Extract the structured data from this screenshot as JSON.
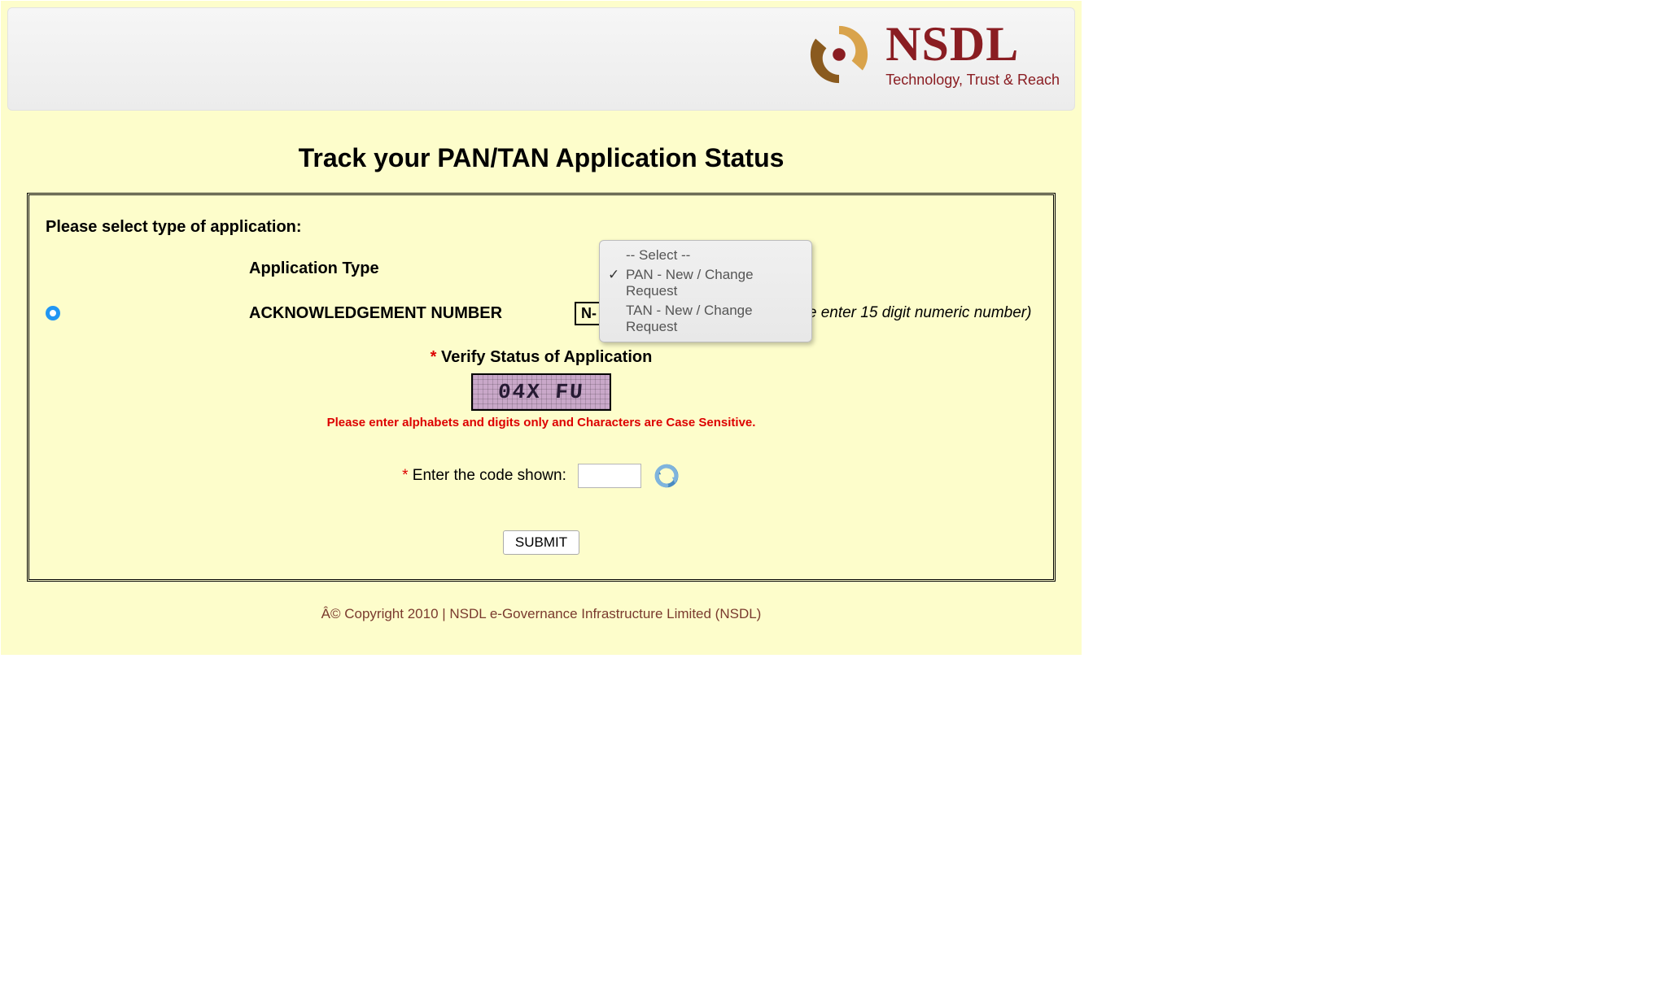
{
  "brand": {
    "name": "NSDL",
    "tagline": "Technology, Trust & Reach",
    "colors": {
      "accent": "#8a1d22",
      "page_bg": "#fdfdcb"
    }
  },
  "title": "Track your PAN/TAN Application Status",
  "form": {
    "prompt": "Please select type of application:",
    "app_type_label": "Application Type",
    "ack_label": "ACKNOWLEDGEMENT NUMBER",
    "ack_prefix": "N-",
    "ack_value": "",
    "ack_hint": "(Please enter 15 digit numeric number)",
    "dropdown": {
      "options": [
        "-- Select --",
        "PAN - New / Change Request",
        "TAN - New / Change Request"
      ],
      "selected_index": 1
    }
  },
  "verify": {
    "asterisk": "*",
    "title": "Verify Status of Application",
    "captcha_text": "04X FU",
    "case_note": "Please enter alphabets and digits only and Characters are Case Sensitive.",
    "enter_label": "Enter the code shown:",
    "code_value": ""
  },
  "submit_label": "SUBMIT",
  "footer": "Â© Copyright 2010  |  NSDL e-Governance Infrastructure Limited (NSDL)"
}
